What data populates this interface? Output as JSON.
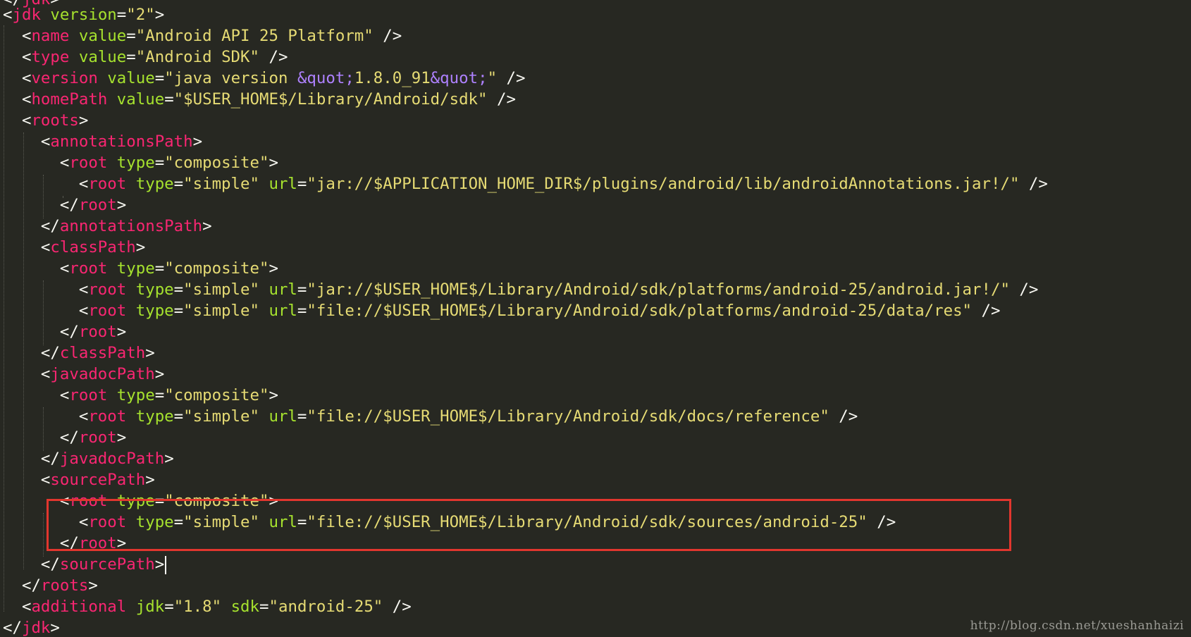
{
  "editor": {
    "theme": "monokai",
    "colors": {
      "background": "#272822",
      "punctuation": "#F8F8F2",
      "tag": "#F92672",
      "attribute": "#A6E22E",
      "string": "#E6DB74",
      "entity": "#AE81FF",
      "highlight_box": "#E2362E"
    },
    "lines": [
      [
        [
          "p",
          "</"
        ],
        [
          "t",
          "jdk"
        ],
        [
          "p",
          ">"
        ]
      ],
      [
        [
          "p",
          "<"
        ],
        [
          "t",
          "jdk"
        ],
        [
          "p",
          " "
        ],
        [
          "a",
          "version"
        ],
        [
          "p",
          "="
        ],
        [
          "s",
          "\"2\""
        ],
        [
          "p",
          ">"
        ]
      ],
      [
        [
          "p",
          "  <"
        ],
        [
          "t",
          "name"
        ],
        [
          "p",
          " "
        ],
        [
          "a",
          "value"
        ],
        [
          "p",
          "="
        ],
        [
          "s",
          "\"Android API 25 Platform\""
        ],
        [
          "p",
          " />"
        ]
      ],
      [
        [
          "p",
          "  <"
        ],
        [
          "t",
          "type"
        ],
        [
          "p",
          " "
        ],
        [
          "a",
          "value"
        ],
        [
          "p",
          "="
        ],
        [
          "s",
          "\"Android SDK\""
        ],
        [
          "p",
          " />"
        ]
      ],
      [
        [
          "p",
          "  <"
        ],
        [
          "t",
          "version"
        ],
        [
          "p",
          " "
        ],
        [
          "a",
          "value"
        ],
        [
          "p",
          "="
        ],
        [
          "s",
          "\"java version "
        ],
        [
          "e",
          "&quot;"
        ],
        [
          "s",
          "1.8.0_91"
        ],
        [
          "e",
          "&quot;"
        ],
        [
          "s",
          "\""
        ],
        [
          "p",
          " />"
        ]
      ],
      [
        [
          "p",
          "  <"
        ],
        [
          "t",
          "homePath"
        ],
        [
          "p",
          " "
        ],
        [
          "a",
          "value"
        ],
        [
          "p",
          "="
        ],
        [
          "s",
          "\"$USER_HOME$/Library/Android/sdk\""
        ],
        [
          "p",
          " />"
        ]
      ],
      [
        [
          "p",
          "  <"
        ],
        [
          "t",
          "roots"
        ],
        [
          "p",
          ">"
        ]
      ],
      [
        [
          "p",
          "    <"
        ],
        [
          "t",
          "annotationsPath"
        ],
        [
          "p",
          ">"
        ]
      ],
      [
        [
          "p",
          "      <"
        ],
        [
          "t",
          "root"
        ],
        [
          "p",
          " "
        ],
        [
          "a",
          "type"
        ],
        [
          "p",
          "="
        ],
        [
          "s",
          "\"composite\""
        ],
        [
          "p",
          ">"
        ]
      ],
      [
        [
          "p",
          "        <"
        ],
        [
          "t",
          "root"
        ],
        [
          "p",
          " "
        ],
        [
          "a",
          "type"
        ],
        [
          "p",
          "="
        ],
        [
          "s",
          "\"simple\""
        ],
        [
          "p",
          " "
        ],
        [
          "a",
          "url"
        ],
        [
          "p",
          "="
        ],
        [
          "s",
          "\"jar://$APPLICATION_HOME_DIR$/plugins/android/lib/androidAnnotations.jar!/\""
        ],
        [
          "p",
          " />"
        ]
      ],
      [
        [
          "p",
          "      </"
        ],
        [
          "t",
          "root"
        ],
        [
          "p",
          ">"
        ]
      ],
      [
        [
          "p",
          "    </"
        ],
        [
          "t",
          "annotationsPath"
        ],
        [
          "p",
          ">"
        ]
      ],
      [
        [
          "p",
          "    <"
        ],
        [
          "t",
          "classPath"
        ],
        [
          "p",
          ">"
        ]
      ],
      [
        [
          "p",
          "      <"
        ],
        [
          "t",
          "root"
        ],
        [
          "p",
          " "
        ],
        [
          "a",
          "type"
        ],
        [
          "p",
          "="
        ],
        [
          "s",
          "\"composite\""
        ],
        [
          "p",
          ">"
        ]
      ],
      [
        [
          "p",
          "        <"
        ],
        [
          "t",
          "root"
        ],
        [
          "p",
          " "
        ],
        [
          "a",
          "type"
        ],
        [
          "p",
          "="
        ],
        [
          "s",
          "\"simple\""
        ],
        [
          "p",
          " "
        ],
        [
          "a",
          "url"
        ],
        [
          "p",
          "="
        ],
        [
          "s",
          "\"jar://$USER_HOME$/Library/Android/sdk/platforms/android-25/android.jar!/\""
        ],
        [
          "p",
          " />"
        ]
      ],
      [
        [
          "p",
          "        <"
        ],
        [
          "t",
          "root"
        ],
        [
          "p",
          " "
        ],
        [
          "a",
          "type"
        ],
        [
          "p",
          "="
        ],
        [
          "s",
          "\"simple\""
        ],
        [
          "p",
          " "
        ],
        [
          "a",
          "url"
        ],
        [
          "p",
          "="
        ],
        [
          "s",
          "\"file://$USER_HOME$/Library/Android/sdk/platforms/android-25/data/res\""
        ],
        [
          "p",
          " />"
        ]
      ],
      [
        [
          "p",
          "      </"
        ],
        [
          "t",
          "root"
        ],
        [
          "p",
          ">"
        ]
      ],
      [
        [
          "p",
          "    </"
        ],
        [
          "t",
          "classPath"
        ],
        [
          "p",
          ">"
        ]
      ],
      [
        [
          "p",
          "    <"
        ],
        [
          "t",
          "javadocPath"
        ],
        [
          "p",
          ">"
        ]
      ],
      [
        [
          "p",
          "      <"
        ],
        [
          "t",
          "root"
        ],
        [
          "p",
          " "
        ],
        [
          "a",
          "type"
        ],
        [
          "p",
          "="
        ],
        [
          "s",
          "\"composite\""
        ],
        [
          "p",
          ">"
        ]
      ],
      [
        [
          "p",
          "        <"
        ],
        [
          "t",
          "root"
        ],
        [
          "p",
          " "
        ],
        [
          "a",
          "type"
        ],
        [
          "p",
          "="
        ],
        [
          "s",
          "\"simple\""
        ],
        [
          "p",
          " "
        ],
        [
          "a",
          "url"
        ],
        [
          "p",
          "="
        ],
        [
          "s",
          "\"file://$USER_HOME$/Library/Android/sdk/docs/reference\""
        ],
        [
          "p",
          " />"
        ]
      ],
      [
        [
          "p",
          "      </"
        ],
        [
          "t",
          "root"
        ],
        [
          "p",
          ">"
        ]
      ],
      [
        [
          "p",
          "    </"
        ],
        [
          "t",
          "javadocPath"
        ],
        [
          "p",
          ">"
        ]
      ],
      [
        [
          "p",
          "    <"
        ],
        [
          "t",
          "sourcePath"
        ],
        [
          "p",
          ">"
        ]
      ],
      [
        [
          "p",
          "      <"
        ],
        [
          "t",
          "root"
        ],
        [
          "p",
          " "
        ],
        [
          "a",
          "type"
        ],
        [
          "p",
          "="
        ],
        [
          "s",
          "\"composite\""
        ],
        [
          "p",
          ">"
        ]
      ],
      [
        [
          "p",
          "        <"
        ],
        [
          "t",
          "root"
        ],
        [
          "p",
          " "
        ],
        [
          "a",
          "type"
        ],
        [
          "p",
          "="
        ],
        [
          "s",
          "\"simple\""
        ],
        [
          "p",
          " "
        ],
        [
          "a",
          "url"
        ],
        [
          "p",
          "="
        ],
        [
          "s",
          "\"file://$USER_HOME$/Library/Android/sdk/sources/android-25\""
        ],
        [
          "p",
          " />"
        ]
      ],
      [
        [
          "p",
          "      </"
        ],
        [
          "t",
          "root"
        ],
        [
          "p",
          ">"
        ]
      ],
      [
        [
          "p",
          "    </"
        ],
        [
          "t",
          "sourcePath"
        ],
        [
          "p",
          ">"
        ],
        [
          "caret",
          ""
        ]
      ],
      [
        [
          "p",
          "  </"
        ],
        [
          "t",
          "roots"
        ],
        [
          "p",
          ">"
        ]
      ],
      [
        [
          "p",
          "  <"
        ],
        [
          "t",
          "additional"
        ],
        [
          "p",
          " "
        ],
        [
          "a",
          "jdk"
        ],
        [
          "p",
          "="
        ],
        [
          "s",
          "\"1.8\""
        ],
        [
          "p",
          " "
        ],
        [
          "a",
          "sdk"
        ],
        [
          "p",
          "="
        ],
        [
          "s",
          "\"android-25\""
        ],
        [
          "p",
          " />"
        ]
      ],
      [
        [
          "p",
          "</"
        ],
        [
          "t",
          "jdk"
        ],
        [
          "p",
          ">"
        ]
      ]
    ]
  },
  "watermark": "http://blog.csdn.net/xueshanhaizi"
}
